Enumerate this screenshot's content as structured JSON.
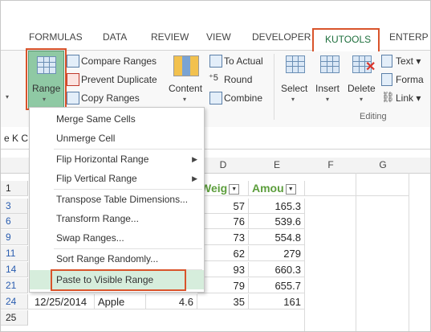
{
  "ribbon": {
    "tabs": [
      "FORMULAS",
      "DATA",
      "REVIEW",
      "VIEW",
      "DEVELOPER",
      "KUTOOLS",
      "ENTERP"
    ],
    "active_tab": "KUTOOLS",
    "range_label": "Range",
    "compare_ranges": "Compare Ranges",
    "prevent_duplicate": "Prevent Duplicate",
    "copy_ranges": "Copy Ranges",
    "content_label": "Content",
    "to_actual": "To Actual",
    "round": "Round",
    "combine": "Combine",
    "select_label": "Select",
    "insert_label": "Insert",
    "delete_label": "Delete",
    "text_label": "Text",
    "format_label": "Forma",
    "link_label": "Link",
    "editing_group": "Editing"
  },
  "namebox_fragment": "e K C",
  "menu": {
    "items": [
      {
        "label": "Merge Same Cells",
        "submenu": false
      },
      {
        "label": "Unmerge Cell",
        "submenu": false
      },
      {
        "label": "Flip Horizontal Range",
        "submenu": true
      },
      {
        "label": "Flip Vertical Range",
        "submenu": true
      },
      {
        "label": "Transpose Table Dimensions...",
        "submenu": false
      },
      {
        "label": "Transform Range...",
        "submenu": false
      },
      {
        "label": "Swap Ranges...",
        "submenu": false
      },
      {
        "label": "Sort Range Randomly...",
        "submenu": false
      },
      {
        "label": "Paste to Visible Range",
        "submenu": false
      }
    ],
    "highlighted": "Paste to Visible Range"
  },
  "sheet": {
    "columns": [
      "D",
      "E",
      "F",
      "G"
    ],
    "header_row": {
      "row": "1",
      "d": "Weig",
      "e": "Amou"
    },
    "rows": [
      {
        "row": "3",
        "d": "57",
        "e": "165.3"
      },
      {
        "row": "6",
        "d": "76",
        "e": "539.6"
      },
      {
        "row": "9",
        "d": "73",
        "e": "554.8"
      },
      {
        "row": "11",
        "d": "62",
        "e": "279"
      },
      {
        "row": "14",
        "d": "93",
        "e": "660.3"
      },
      {
        "row": "21",
        "d": "79",
        "e": "655.7"
      }
    ],
    "last_row": {
      "row": "24",
      "a": "12/25/2014",
      "b": "Apple",
      "c": "4.6",
      "d": "35",
      "e": "161"
    },
    "blank_row": "25"
  }
}
